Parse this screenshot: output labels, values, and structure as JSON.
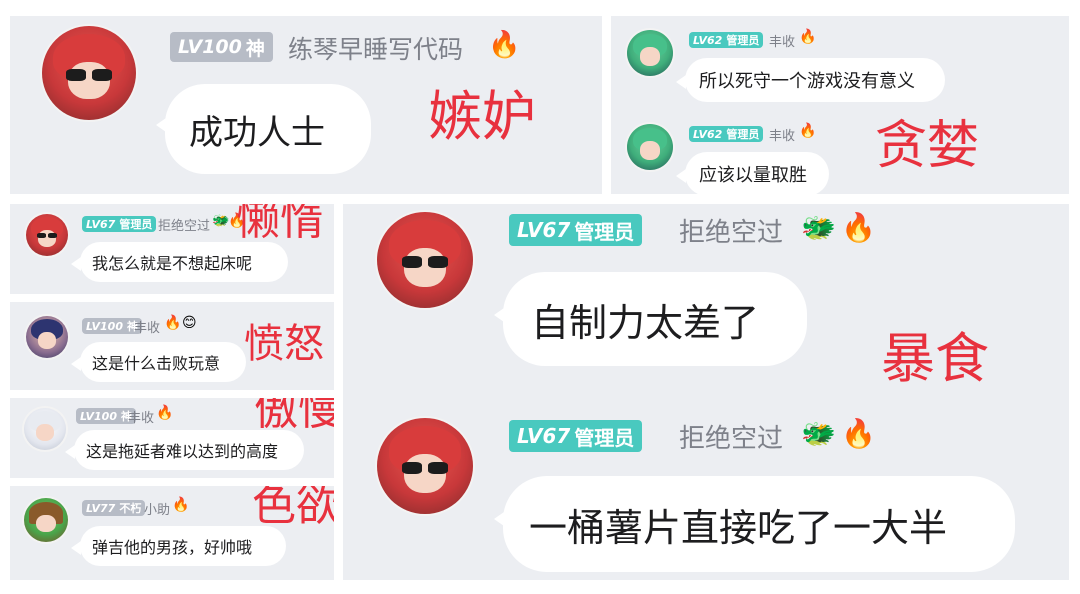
{
  "panels": {
    "envy": {
      "badge_level": "LV100",
      "badge_title": "神",
      "username": "练琴早睡写代码",
      "flame": "🔥",
      "message": "成功人士",
      "sin": "嫉妒"
    },
    "greed": {
      "sin": "贪婪",
      "messages": [
        {
          "badge_level": "LV62",
          "badge_title": "管理员",
          "username": "丰收",
          "flame": "🔥",
          "message": "所以死守一个游戏没有意义"
        },
        {
          "badge_level": "LV62",
          "badge_title": "管理员",
          "username": "丰收",
          "flame": "🔥",
          "message": "应该以量取胜"
        }
      ]
    },
    "sloth": {
      "badge_level": "LV67",
      "badge_title": "管理员",
      "username": "拒绝空过",
      "dragon": "🐲",
      "flame": "🔥",
      "message": "我怎么就是不想起床呢",
      "sin": "懒惰"
    },
    "wrath": {
      "badge_level": "LV100",
      "badge_title": "神",
      "username": "丰收",
      "flame": "🔥",
      "extra": "😊",
      "message": "这是什么击败玩意",
      "sin": "愤怒"
    },
    "pride": {
      "badge_level": "LV100",
      "badge_title": "神",
      "username": "丰收",
      "flame": "🔥",
      "message": "这是拖延者难以达到的高度",
      "sin": "傲慢"
    },
    "lust": {
      "badge_level": "LV77",
      "badge_title": "不朽",
      "username": "小助",
      "flame": "🔥",
      "message": "弹吉他的男孩，好帅哦",
      "sin": "色欲"
    },
    "gluttony": {
      "sin": "暴食",
      "messages": [
        {
          "badge_level": "LV67",
          "badge_title": "管理员",
          "username": "拒绝空过",
          "dragon": "🐲",
          "flame": "🔥",
          "message": "自制力太差了"
        },
        {
          "badge_level": "LV67",
          "badge_title": "管理员",
          "username": "拒绝空过",
          "dragon": "🐲",
          "flame": "🔥",
          "message": "一桶薯片直接吃了一大半"
        }
      ]
    }
  }
}
